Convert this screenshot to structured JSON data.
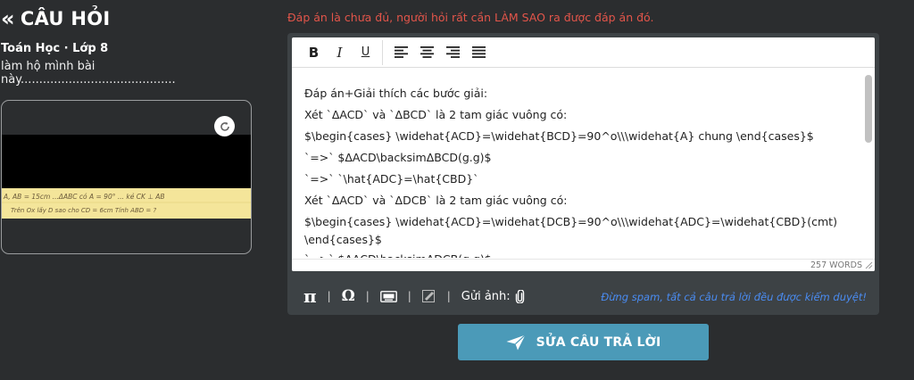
{
  "header": {
    "back_icon": "double-chevron-left-icon",
    "title": "CÂU HỎI"
  },
  "question": {
    "subject": "Toán Học · Lớp 8",
    "text": "làm hộ mình bài này..........................................",
    "image_strip_text": {
      "line1": "A, AB = 15cm  ...ΔABC có A = 90°  ... kẻ CK ⊥ AB",
      "line2": "Trên Ox lấy D sao cho CD = 6cm  Tính ABD = ?"
    }
  },
  "answer": {
    "hint": "Đáp án là chưa đủ, người hỏi rất cần LÀM SAO ra được đáp án đó.",
    "toolbar": {
      "bold": "B",
      "italic": "I",
      "underline": "U"
    },
    "content_lines": [
      "Đáp án+Giải thích các bước giải:",
      " Xét `ΔACD` và `ΔBCD` là 2 tam giác vuông có:",
      "$\\begin{cases} \\widehat{ACD}=\\widehat{BCD}=90^o\\\\\\widehat{A} chung \\end{cases}$",
      "`=>` $ΔACD\\backsimΔBCD(g.g)$",
      "`=>` `\\hat{ADC}=\\hat{CBD}`",
      "Xét `ΔACD` và `ΔDCB` là 2 tam giác vuông có:",
      "$\\begin{cases} \\widehat{ACD}=\\widehat{DCB}=90^o\\\\\\widehat{ADC}=\\widehat{CBD}(cmt) \\end{cases}$",
      "`=>` $ΔACD\\backsimΔDCB(g.g)$"
    ],
    "word_count": "257 WORDS",
    "tools": {
      "pi": "π",
      "omega": "Ω",
      "upload_label": "Gửi ảnh:"
    },
    "spam_note": "Đừng spam, tất cả câu trả lời đều được kiểm duyệt!",
    "submit_label": "SỬA CÂU TRẢ LỜI"
  },
  "colors": {
    "background": "#2b2d2f",
    "hint": "#e2554a",
    "spam_note": "#4a8cf2",
    "submit": "#4b9ab8"
  }
}
